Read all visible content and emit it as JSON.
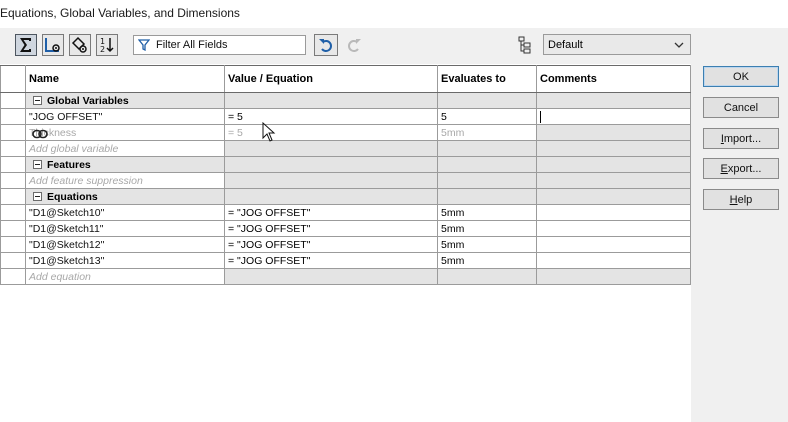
{
  "window": {
    "title": "Equations, Global Variables, and Dimensions"
  },
  "toolbar": {
    "filter_placeholder": "Filter All Fields",
    "config_value": "Default",
    "buttons": [
      "equation-view-icon",
      "sketch-equation-view-icon",
      "dimension-view-icon",
      "ordered-view-icon",
      "undo-icon",
      "redo-icon",
      "configuration-tree-icon"
    ]
  },
  "columns": {
    "name": "Name",
    "value": "Value / Equation",
    "evaluates": "Evaluates to",
    "comments": "Comments"
  },
  "sections": {
    "global": {
      "label": "Global Variables",
      "rows": [
        {
          "name": "\"JOG OFFSET\"",
          "value": "= 5",
          "evaluates": "5",
          "comments": ""
        },
        {
          "name": "Thickness",
          "value": "= 5",
          "evaluates": "5mm",
          "comments": ""
        }
      ],
      "add_hint": "Add global variable"
    },
    "features": {
      "label": "Features",
      "add_hint": "Add feature suppression"
    },
    "equations": {
      "label": "Equations",
      "rows": [
        {
          "name": "\"D1@Sketch10\"",
          "value": "= \"JOG OFFSET\"",
          "evaluates": "5mm"
        },
        {
          "name": "\"D1@Sketch11\"",
          "value": "= \"JOG OFFSET\"",
          "evaluates": "5mm"
        },
        {
          "name": "\"D1@Sketch12\"",
          "value": "= \"JOG OFFSET\"",
          "evaluates": "5mm"
        },
        {
          "name": "\"D1@Sketch13\"",
          "value": "= \"JOG OFFSET\"",
          "evaluates": "5mm"
        }
      ],
      "add_hint": "Add equation"
    }
  },
  "dialog_buttons": {
    "ok": "OK",
    "cancel": "Cancel",
    "import_prefix": "I",
    "import_rest": "mport...",
    "export_prefix": "E",
    "export_rest": "xport...",
    "help_prefix": "H",
    "help_rest": "elp"
  }
}
